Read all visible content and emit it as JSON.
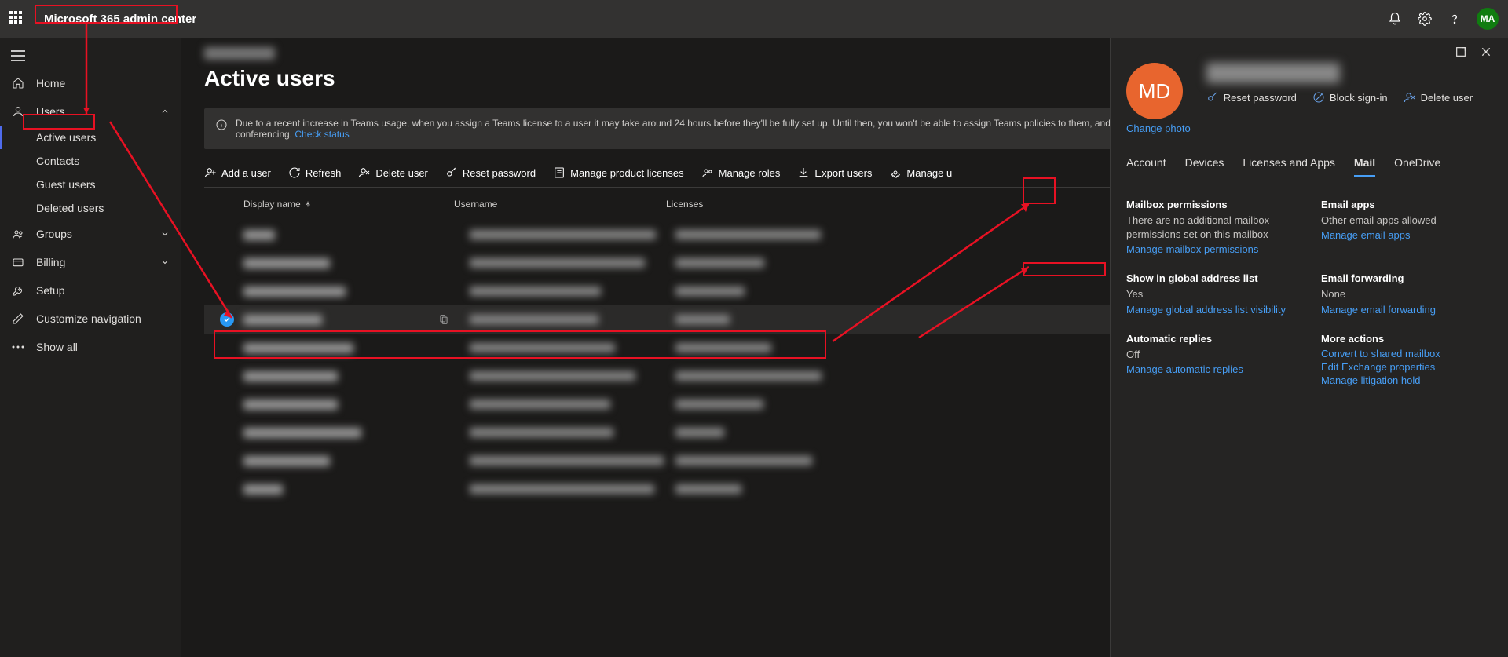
{
  "app_title": "Microsoft 365 admin center",
  "avatar_initials": "MA",
  "sidebar": {
    "home": "Home",
    "users": "Users",
    "active_users": "Active users",
    "contacts": "Contacts",
    "guest_users": "Guest users",
    "deleted_users": "Deleted users",
    "groups": "Groups",
    "billing": "Billing",
    "setup": "Setup",
    "customize": "Customize navigation",
    "show_all": "Show all"
  },
  "page": {
    "title": "Active users",
    "info_text": "Due to a recent increase in Teams usage, when you assign a Teams license to a user it may take around 24 hours before they'll be fully set up. Until then, you won't be able to assign Teams policies to them, and they might not have access to some Teams features like calling and audio conferencing.",
    "info_link": "Check status"
  },
  "toolbar": {
    "add_user": "Add a user",
    "refresh": "Refresh",
    "delete_user": "Delete user",
    "reset_password": "Reset password",
    "product_licenses": "Manage product licenses",
    "manage_roles": "Manage roles",
    "export_users": "Export users",
    "manage_u": "Manage u"
  },
  "table": {
    "col_name": "Display name",
    "col_user": "Username",
    "col_lic": "Licenses",
    "rows": [
      {
        "selected": false,
        "nw": 40
      },
      {
        "selected": false,
        "nw": 110
      },
      {
        "selected": false,
        "nw": 130
      },
      {
        "selected": true,
        "nw": 100
      },
      {
        "selected": false,
        "nw": 140
      },
      {
        "selected": false,
        "nw": 120
      },
      {
        "selected": false,
        "nw": 120
      },
      {
        "selected": false,
        "nw": 150
      },
      {
        "selected": false,
        "nw": 110
      },
      {
        "selected": false,
        "nw": 50
      }
    ]
  },
  "panel": {
    "avatar_initials": "MD",
    "change_photo": "Change photo",
    "reset_pw": "Reset password",
    "block_signin": "Block sign-in",
    "delete_user": "Delete user",
    "tabs": {
      "account": "Account",
      "devices": "Devices",
      "licenses": "Licenses and Apps",
      "mail": "Mail",
      "onedrive": "OneDrive"
    },
    "mailbox_perm_title": "Mailbox permissions",
    "mailbox_perm_text": "There are no additional mailbox permissions set on this mailbox",
    "mailbox_perm_link": "Manage mailbox permissions",
    "email_apps_title": "Email apps",
    "email_apps_text": "Other email apps allowed",
    "email_apps_link": "Manage email apps",
    "gal_title": "Show in global address list",
    "gal_text": "Yes",
    "gal_link": "Manage global address list visibility",
    "fwd_title": "Email forwarding",
    "fwd_text": "None",
    "fwd_link": "Manage email forwarding",
    "auto_title": "Automatic replies",
    "auto_text": "Off",
    "auto_link": "Manage automatic replies",
    "more_title": "More actions",
    "more_link1": "Convert to shared mailbox",
    "more_link2": "Edit Exchange properties",
    "more_link3": "Manage litigation hold"
  }
}
